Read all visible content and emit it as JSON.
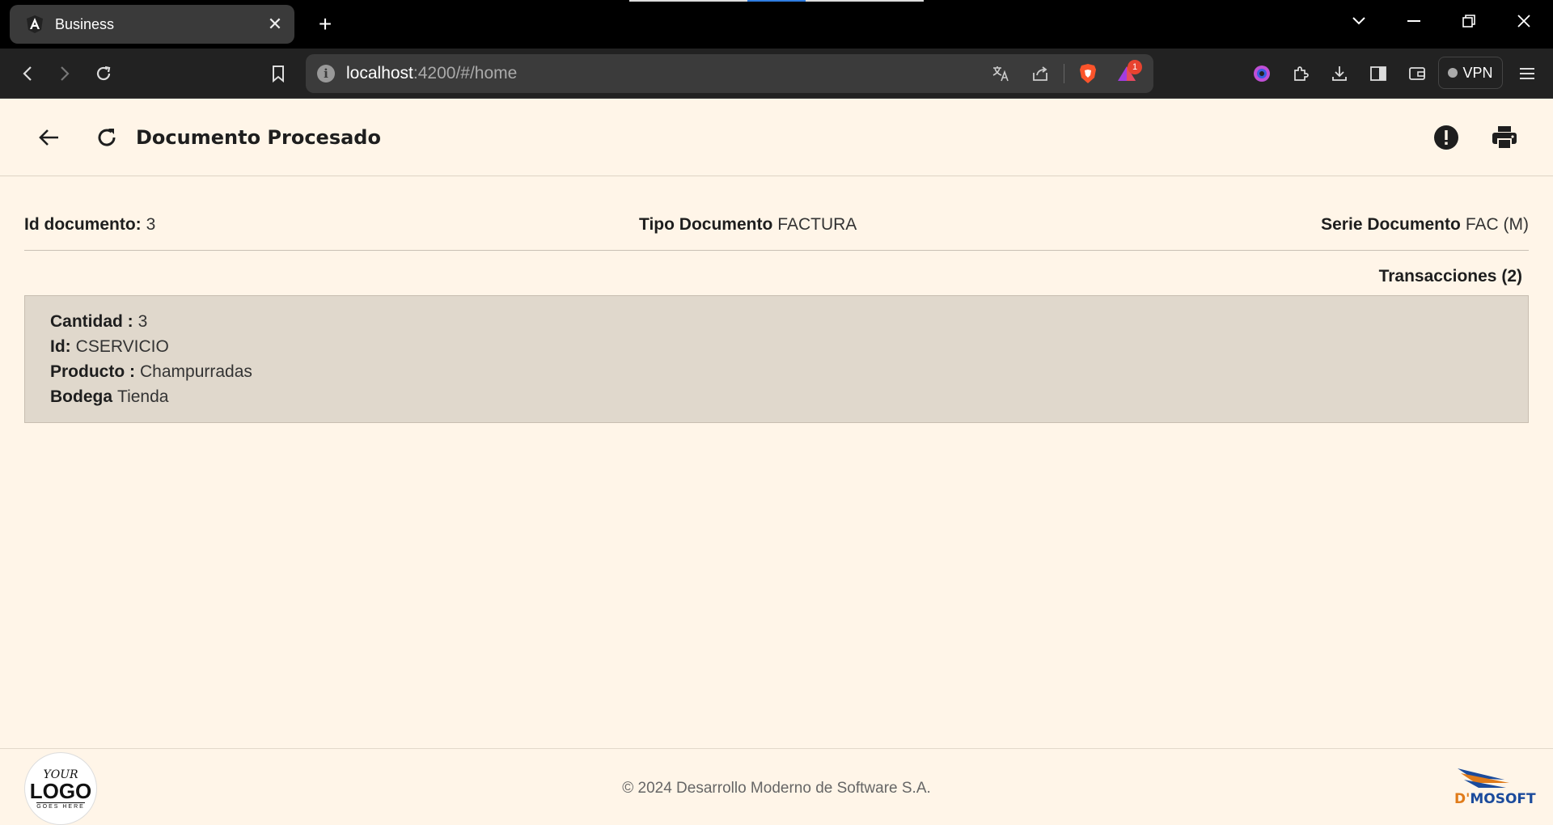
{
  "browser": {
    "tab_title": "Business",
    "tab_close": "✕",
    "new_tab": "+",
    "url_host": "localhost",
    "url_rest": ":4200/#/home",
    "vpn_label": "VPN",
    "alert_badge": "1"
  },
  "header": {
    "title": "Documento Procesado"
  },
  "document": {
    "id_label": "Id documento:",
    "id_value": "3",
    "type_label": "Tipo Documento",
    "type_value": "FACTURA",
    "series_label": "Serie Documento",
    "series_value": "FAC (M)"
  },
  "transactions": {
    "title": "Transacciones (2)",
    "items": [
      {
        "qty_label": "Cantidad :",
        "qty_value": "3",
        "id_label": "Id:",
        "id_value": "CSERVICIO",
        "product_label": "Producto :",
        "product_value": "Champurradas",
        "warehouse_label": "Bodega",
        "warehouse_value": "Tienda"
      }
    ]
  },
  "footer": {
    "copyright": "© 2024 Desarrollo Moderno de Software S.A.",
    "logo_line1": "YOUR",
    "logo_line2": "LOGO",
    "logo_line3": "GOES HERE",
    "brand_prefix": "D'",
    "brand_name": "MOSOFT"
  },
  "colors": {
    "background": "#fff5e8",
    "card": "#e0d8cc",
    "chrome": "#222222"
  }
}
